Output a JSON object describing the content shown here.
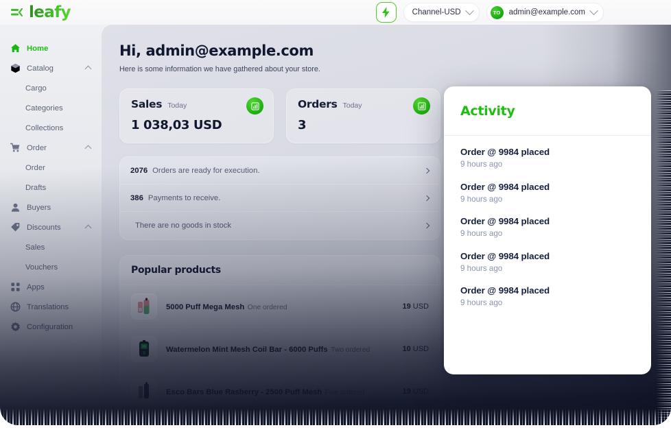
{
  "topbar": {
    "collapse_icon": "collapse-sidebar-icon",
    "brand": "leafy",
    "bolt_icon": "lightning-bolt-icon",
    "channel": {
      "label": "Channel-USD",
      "chevron_icon": "chevron-down-icon"
    },
    "account": {
      "avatar_initials": "TO",
      "label": "admin@example.com",
      "chevron_icon": "chevron-down-icon"
    }
  },
  "sidebar": {
    "items": [
      {
        "label": "Home",
        "icon": "home-icon",
        "type": "item",
        "active": true,
        "expandable": false
      },
      {
        "label": "Catalog",
        "icon": "box-icon",
        "type": "item",
        "active": false,
        "expandable": true
      },
      {
        "label": "Cargo",
        "icon": "",
        "type": "sub",
        "active": false,
        "expandable": false
      },
      {
        "label": "Categories",
        "icon": "",
        "type": "sub",
        "active": false,
        "expandable": false
      },
      {
        "label": "Collections",
        "icon": "",
        "type": "sub",
        "active": false,
        "expandable": false
      },
      {
        "label": "Order",
        "icon": "cart-icon",
        "type": "item",
        "active": false,
        "expandable": true
      },
      {
        "label": "Order",
        "icon": "",
        "type": "sub",
        "active": false,
        "expandable": false
      },
      {
        "label": "Drafts",
        "icon": "",
        "type": "sub",
        "active": false,
        "expandable": false
      },
      {
        "label": "Buyers",
        "icon": "user-icon",
        "type": "item",
        "active": false,
        "expandable": false
      },
      {
        "label": "Discounts",
        "icon": "tag-icon",
        "type": "item",
        "active": false,
        "expandable": true
      },
      {
        "label": "Sales",
        "icon": "",
        "type": "sub",
        "active": false,
        "expandable": false
      },
      {
        "label": "Vouchers",
        "icon": "",
        "type": "sub",
        "active": false,
        "expandable": false
      },
      {
        "label": "Apps",
        "icon": "grid-icon",
        "type": "item",
        "active": false,
        "expandable": false
      },
      {
        "label": "Translations",
        "icon": "globe-icon",
        "type": "item",
        "active": false,
        "expandable": false
      },
      {
        "label": "Configuration",
        "icon": "gear-icon",
        "type": "item",
        "active": false,
        "expandable": false
      }
    ]
  },
  "main": {
    "greeting": "Hi, admin@example.com",
    "subgreeting": "Here is some information we have gathered about your store.",
    "stats": [
      {
        "title": "Sales",
        "period": "Today",
        "value": "1 038,03 USD",
        "badge_icon": "bar-chart-icon"
      },
      {
        "title": "Orders",
        "period": "Today",
        "value": "3",
        "badge_icon": "bar-chart-icon"
      }
    ],
    "tasks": [
      {
        "count": "2076",
        "text": "Orders are ready for execution.",
        "arrow_icon": "chevron-right-icon"
      },
      {
        "count": "386",
        "text": "Payments to receive.",
        "arrow_icon": "chevron-right-icon"
      },
      {
        "count": "",
        "text": "There are no goods in stock",
        "arrow_icon": "chevron-right-icon"
      }
    ],
    "popular": {
      "title": "Popular products",
      "products": [
        {
          "name": "5000 Puff Mega Mesh",
          "sub": "One ordered",
          "price": "19",
          "currency": "USD",
          "thumb": "vape-pink-green-thumbnail"
        },
        {
          "name": "Watermelon Mint Mesh Coil Bar - 6000 Puffs",
          "sub": "Two ordered",
          "price": "10",
          "currency": "USD",
          "thumb": "vape-dark-green-thumbnail"
        },
        {
          "name": "Esco Bars Blue Rasberry - 2500 Puff Mesh",
          "sub": "Five ordered",
          "price": "19",
          "currency": "USD",
          "thumb": "vape-blue-thumbnail"
        }
      ]
    }
  },
  "activity": {
    "title": "Activity",
    "items": [
      {
        "title": "Order @ 9984 placed",
        "time": "9 hours ago"
      },
      {
        "title": "Order @ 9984 placed",
        "time": "9 hours ago"
      },
      {
        "title": "Order @ 9984 placed",
        "time": "9 hours ago"
      },
      {
        "title": "Order @ 9984 placed",
        "time": "9 hours ago"
      },
      {
        "title": "Order @ 9984 placed",
        "time": "9 hours ago"
      }
    ]
  },
  "colors": {
    "brand_green": "#1fbf12",
    "accent_green": "#4ccb2e",
    "text_dark": "#10182f",
    "text_muted": "#6d7389",
    "panel_white": "#ffffff",
    "overlay_dark": "#0d1224"
  }
}
